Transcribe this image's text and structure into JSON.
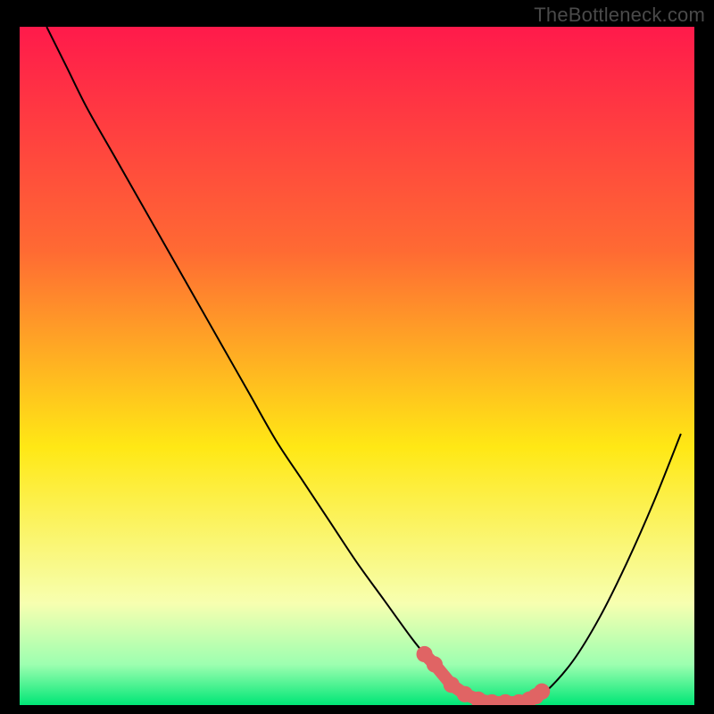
{
  "watermark": "TheBottleneck.com",
  "colors": {
    "background": "#000000",
    "gradient_top": "#ff1a4b",
    "gradient_mid_upper": "#ff6a33",
    "gradient_mid": "#ffe815",
    "gradient_lower": "#f7ffb0",
    "gradient_green1": "#9dffb0",
    "gradient_green2": "#00e676",
    "curve": "#000000",
    "marker": "#e06464"
  },
  "chart_data": {
    "type": "line",
    "title": "",
    "xlabel": "",
    "ylabel": "",
    "xlim": [
      0,
      100
    ],
    "ylim": [
      0,
      100
    ],
    "series": [
      {
        "name": "bottleneck-curve",
        "x": [
          4,
          7,
          10,
          14,
          18,
          22,
          26,
          30,
          34,
          38,
          42,
          46,
          50,
          54,
          58,
          60,
          62,
          64,
          66,
          68,
          70,
          72,
          74,
          76,
          78,
          82,
          86,
          90,
          94,
          98
        ],
        "y": [
          100,
          94,
          88,
          81,
          74,
          67,
          60,
          53,
          46,
          39,
          33,
          27,
          21,
          15.5,
          10,
          7.5,
          5,
          3,
          1.6,
          0.8,
          0.4,
          0.4,
          0.4,
          0.9,
          2,
          6.5,
          13,
          21,
          30,
          40
        ]
      }
    ],
    "markers": {
      "name": "highlighted-points",
      "x": [
        60,
        61.5,
        64,
        66,
        68,
        70,
        72,
        74,
        75.5,
        76.5,
        77.4
      ],
      "y": [
        7.5,
        6.0,
        3.0,
        1.6,
        0.8,
        0.4,
        0.4,
        0.4,
        0.8,
        1.3,
        2.0
      ]
    }
  }
}
